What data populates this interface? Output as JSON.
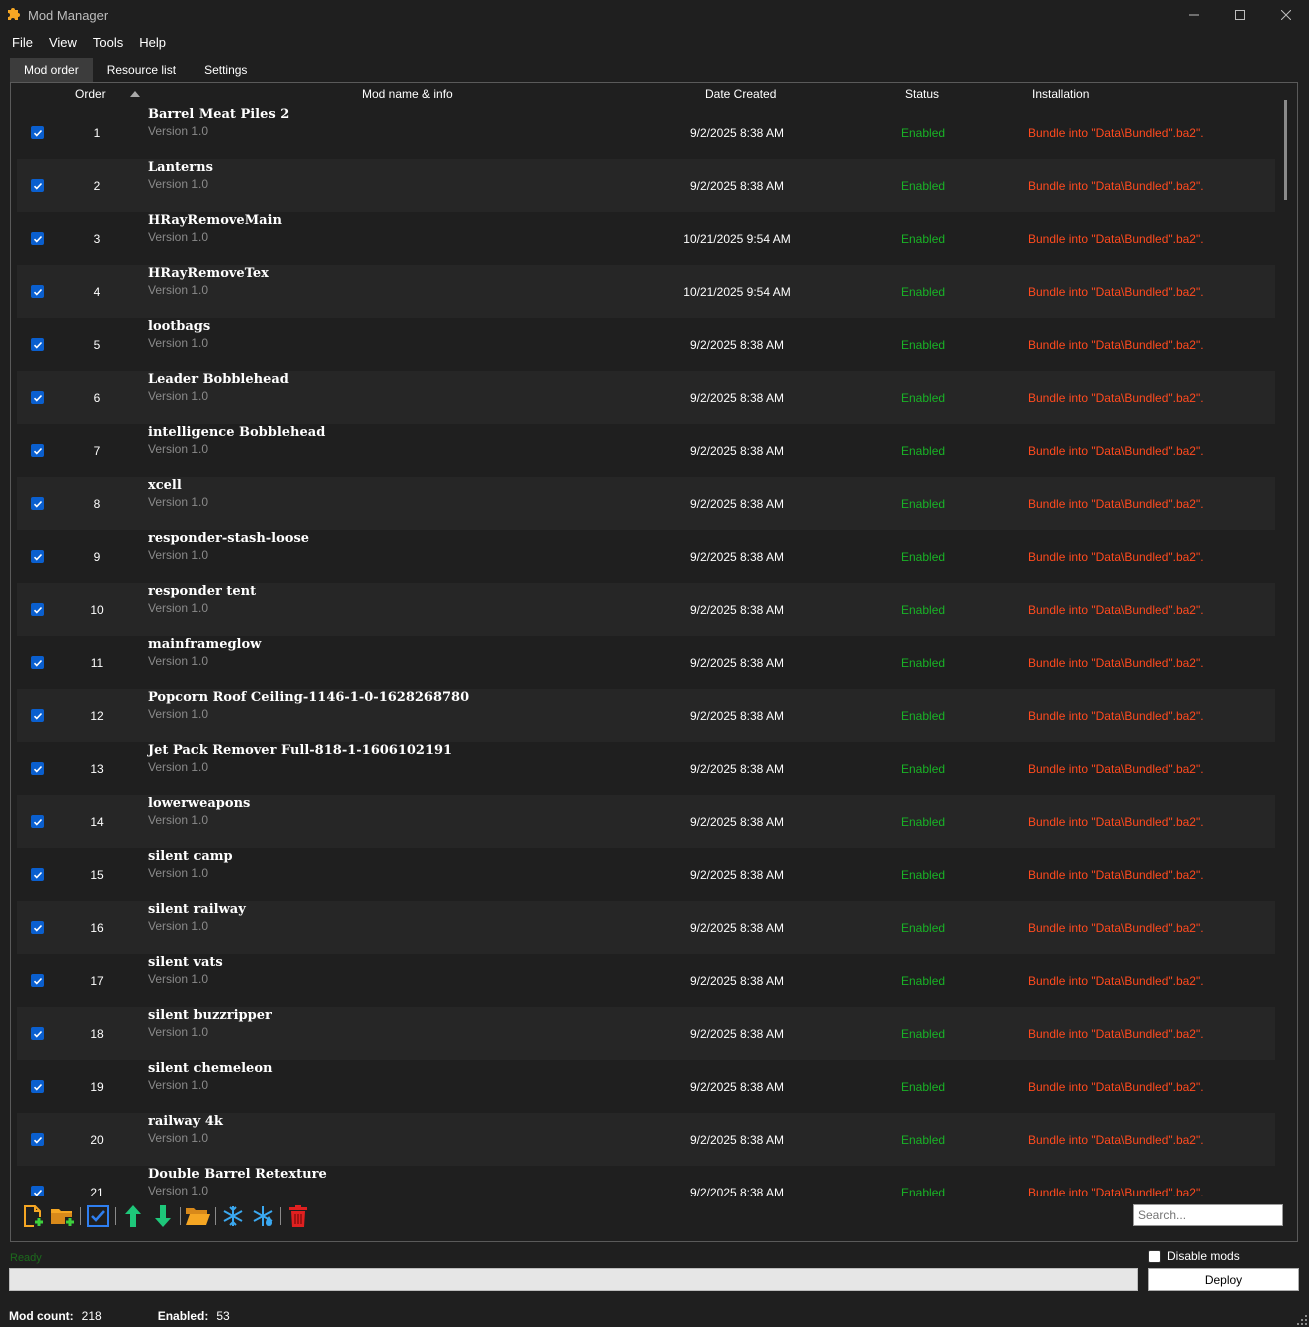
{
  "window": {
    "title": "Mod Manager",
    "icon": "puzzle-icon",
    "accent": "#f5a623"
  },
  "menu": [
    "File",
    "View",
    "Tools",
    "Help"
  ],
  "tabs": [
    {
      "label": "Mod order",
      "active": true
    },
    {
      "label": "Resource list",
      "active": false
    },
    {
      "label": "Settings",
      "active": false
    }
  ],
  "columns": {
    "order": "Order",
    "name": "Mod name & info",
    "date": "Date Created",
    "status": "Status",
    "installation": "Installation"
  },
  "mods": [
    {
      "order": "1",
      "name": "Barrel Meat Piles 2",
      "version": "Version 1.0",
      "date": "9/2/2025 8:38 AM",
      "status": "Enabled",
      "installation": "Bundle into \"Data\\Bundled\".ba2\"."
    },
    {
      "order": "2",
      "name": "Lanterns",
      "version": "Version 1.0",
      "date": "9/2/2025 8:38 AM",
      "status": "Enabled",
      "installation": "Bundle into \"Data\\Bundled\".ba2\"."
    },
    {
      "order": "3",
      "name": "HRayRemoveMain",
      "version": "Version 1.0",
      "date": "10/21/2025 9:54 AM",
      "status": "Enabled",
      "installation": "Bundle into \"Data\\Bundled\".ba2\"."
    },
    {
      "order": "4",
      "name": "HRayRemoveTex",
      "version": "Version 1.0",
      "date": "10/21/2025 9:54 AM",
      "status": "Enabled",
      "installation": "Bundle into \"Data\\Bundled\".ba2\"."
    },
    {
      "order": "5",
      "name": "lootbags",
      "version": "Version 1.0",
      "date": "9/2/2025 8:38 AM",
      "status": "Enabled",
      "installation": "Bundle into \"Data\\Bundled\".ba2\"."
    },
    {
      "order": "6",
      "name": "Leader Bobblehead",
      "version": "Version 1.0",
      "date": "9/2/2025 8:38 AM",
      "status": "Enabled",
      "installation": "Bundle into \"Data\\Bundled\".ba2\"."
    },
    {
      "order": "7",
      "name": "intelligence Bobblehead",
      "version": "Version 1.0",
      "date": "9/2/2025 8:38 AM",
      "status": "Enabled",
      "installation": "Bundle into \"Data\\Bundled\".ba2\"."
    },
    {
      "order": "8",
      "name": "xcell",
      "version": "Version 1.0",
      "date": "9/2/2025 8:38 AM",
      "status": "Enabled",
      "installation": "Bundle into \"Data\\Bundled\".ba2\"."
    },
    {
      "order": "9",
      "name": "responder-stash-loose",
      "version": "Version 1.0",
      "date": "9/2/2025 8:38 AM",
      "status": "Enabled",
      "installation": "Bundle into \"Data\\Bundled\".ba2\"."
    },
    {
      "order": "10",
      "name": "responder tent",
      "version": "Version 1.0",
      "date": "9/2/2025 8:38 AM",
      "status": "Enabled",
      "installation": "Bundle into \"Data\\Bundled\".ba2\"."
    },
    {
      "order": "11",
      "name": "mainframeglow",
      "version": "Version 1.0",
      "date": "9/2/2025 8:38 AM",
      "status": "Enabled",
      "installation": "Bundle into \"Data\\Bundled\".ba2\"."
    },
    {
      "order": "12",
      "name": "Popcorn  Roof  Ceiling-1146-1-0-1628268780",
      "version": "Version 1.0",
      "date": "9/2/2025 8:38 AM",
      "status": "Enabled",
      "installation": "Bundle into \"Data\\Bundled\".ba2\"."
    },
    {
      "order": "13",
      "name": "Jet Pack Remover Full-818-1-1606102191",
      "version": "Version 1.0",
      "date": "9/2/2025 8:38 AM",
      "status": "Enabled",
      "installation": "Bundle into \"Data\\Bundled\".ba2\"."
    },
    {
      "order": "14",
      "name": "lowerweapons",
      "version": "Version 1.0",
      "date": "9/2/2025 8:38 AM",
      "status": "Enabled",
      "installation": "Bundle into \"Data\\Bundled\".ba2\"."
    },
    {
      "order": "15",
      "name": "silent camp",
      "version": "Version 1.0",
      "date": "9/2/2025 8:38 AM",
      "status": "Enabled",
      "installation": "Bundle into \"Data\\Bundled\".ba2\"."
    },
    {
      "order": "16",
      "name": "silent railway",
      "version": "Version 1.0",
      "date": "9/2/2025 8:38 AM",
      "status": "Enabled",
      "installation": "Bundle into \"Data\\Bundled\".ba2\"."
    },
    {
      "order": "17",
      "name": "silent vats",
      "version": "Version 1.0",
      "date": "9/2/2025 8:38 AM",
      "status": "Enabled",
      "installation": "Bundle into \"Data\\Bundled\".ba2\"."
    },
    {
      "order": "18",
      "name": "silent buzzripper",
      "version": "Version 1.0",
      "date": "9/2/2025 8:38 AM",
      "status": "Enabled",
      "installation": "Bundle into \"Data\\Bundled\".ba2\"."
    },
    {
      "order": "19",
      "name": "silent chemeleon",
      "version": "Version 1.0",
      "date": "9/2/2025 8:38 AM",
      "status": "Enabled",
      "installation": "Bundle into \"Data\\Bundled\".ba2\"."
    },
    {
      "order": "20",
      "name": "railway 4k",
      "version": "Version 1.0",
      "date": "9/2/2025 8:38 AM",
      "status": "Enabled",
      "installation": "Bundle into \"Data\\Bundled\".ba2\"."
    },
    {
      "order": "21",
      "name": "Double Barrel Retexture",
      "version": "Version 1.0",
      "date": "9/2/2025 8:38 AM",
      "status": "Enabled",
      "installation": "Bundle into \"Data\\Bundled\".ba2\"."
    }
  ],
  "toolbar": {
    "icons": [
      "add-file-icon",
      "add-folder-icon",
      "select-all-checkbox-icon",
      "move-up-icon",
      "move-down-icon",
      "open-folder-icon",
      "freeze-icon",
      "unfreeze-icon",
      "delete-icon"
    ]
  },
  "search": {
    "placeholder": "Search..."
  },
  "status": {
    "ready_text": "Ready",
    "progress": 0
  },
  "disable_mods": {
    "label": "Disable mods",
    "checked": false
  },
  "deploy": {
    "label": "Deploy"
  },
  "footer": {
    "mod_count_label": "Mod count:",
    "mod_count": "218",
    "enabled_label": "Enabled:",
    "enabled": "53"
  },
  "colors": {
    "enabled": "#19b326",
    "installation": "#ff4a1f",
    "checkbox": "#0a5fcf",
    "background": "#1f1f1f"
  }
}
